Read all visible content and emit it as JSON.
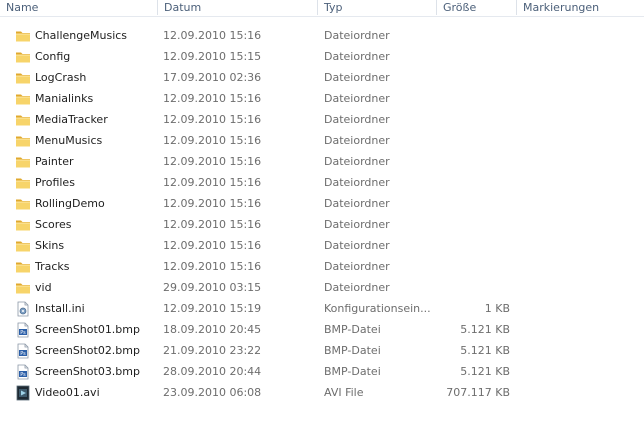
{
  "columns": {
    "name": "Name",
    "date": "Datum",
    "type": "Typ",
    "size": "Größe",
    "tags": "Markierungen"
  },
  "files": [
    {
      "name": "ChallengeMusics",
      "date": "12.09.2010 15:16",
      "type": "Dateiordner",
      "size": "",
      "icon": "folder-icon"
    },
    {
      "name": "Config",
      "date": "12.09.2010 15:15",
      "type": "Dateiordner",
      "size": "",
      "icon": "folder-icon"
    },
    {
      "name": "LogCrash",
      "date": "17.09.2010 02:36",
      "type": "Dateiordner",
      "size": "",
      "icon": "folder-icon"
    },
    {
      "name": "Manialinks",
      "date": "12.09.2010 15:16",
      "type": "Dateiordner",
      "size": "",
      "icon": "folder-icon"
    },
    {
      "name": "MediaTracker",
      "date": "12.09.2010 15:16",
      "type": "Dateiordner",
      "size": "",
      "icon": "folder-icon"
    },
    {
      "name": "MenuMusics",
      "date": "12.09.2010 15:16",
      "type": "Dateiordner",
      "size": "",
      "icon": "folder-icon"
    },
    {
      "name": "Painter",
      "date": "12.09.2010 15:16",
      "type": "Dateiordner",
      "size": "",
      "icon": "folder-icon"
    },
    {
      "name": "Profiles",
      "date": "12.09.2010 15:16",
      "type": "Dateiordner",
      "size": "",
      "icon": "folder-icon"
    },
    {
      "name": "RollingDemo",
      "date": "12.09.2010 15:16",
      "type": "Dateiordner",
      "size": "",
      "icon": "folder-icon"
    },
    {
      "name": "Scores",
      "date": "12.09.2010 15:16",
      "type": "Dateiordner",
      "size": "",
      "icon": "folder-icon"
    },
    {
      "name": "Skins",
      "date": "12.09.2010 15:16",
      "type": "Dateiordner",
      "size": "",
      "icon": "folder-icon"
    },
    {
      "name": "Tracks",
      "date": "12.09.2010 15:16",
      "type": "Dateiordner",
      "size": "",
      "icon": "folder-icon"
    },
    {
      "name": "vid",
      "date": "29.09.2010 03:15",
      "type": "Dateiordner",
      "size": "",
      "icon": "folder-icon"
    },
    {
      "name": "Install.ini",
      "date": "12.09.2010 15:19",
      "type": "Konfigurationsein...",
      "size": "1 KB",
      "icon": "ini-file-icon"
    },
    {
      "name": "ScreenShot01.bmp",
      "date": "18.09.2010 20:45",
      "type": "BMP-Datei",
      "size": "5.121 KB",
      "icon": "bmp-file-icon"
    },
    {
      "name": "ScreenShot02.bmp",
      "date": "21.09.2010 23:22",
      "type": "BMP-Datei",
      "size": "5.121 KB",
      "icon": "bmp-file-icon"
    },
    {
      "name": "ScreenShot03.bmp",
      "date": "28.09.2010 20:44",
      "type": "BMP-Datei",
      "size": "5.121 KB",
      "icon": "bmp-file-icon"
    },
    {
      "name": "Video01.avi",
      "date": "23.09.2010 06:08",
      "type": "AVI File",
      "size": "707.117 KB",
      "icon": "video-file-icon"
    }
  ],
  "colors": {
    "header_text": "#4c607a",
    "name_text": "#1e1e1e",
    "detail_text": "#6d6d6d",
    "folder_yellow": "#f2c34e"
  }
}
